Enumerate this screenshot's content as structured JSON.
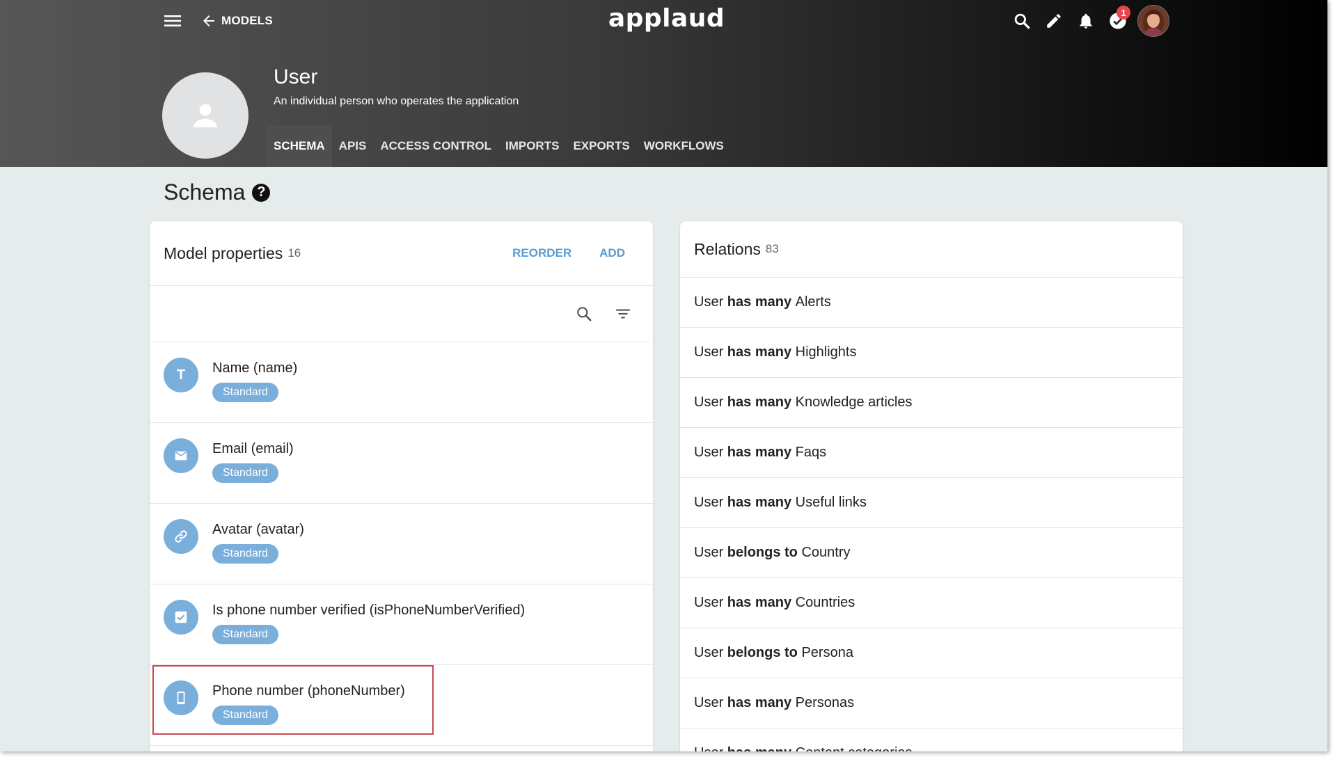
{
  "header": {
    "back_label": "MODELS",
    "logo": "applaud",
    "notification_count": "1",
    "icons": [
      "menu-icon",
      "arrow-left-icon",
      "search-icon",
      "pencil-icon",
      "bell-icon",
      "check-circle-icon"
    ]
  },
  "model": {
    "title": "User",
    "description": "An individual person who operates the application"
  },
  "tabs": [
    {
      "label": "SCHEMA",
      "active": true
    },
    {
      "label": "APIS"
    },
    {
      "label": "ACCESS CONTROL"
    },
    {
      "label": "IMPORTS"
    },
    {
      "label": "EXPORTS"
    },
    {
      "label": "WORKFLOWS"
    }
  ],
  "section": {
    "title": "Schema",
    "help_glyph": "?"
  },
  "properties": {
    "title": "Model properties",
    "count": "16",
    "reorder_label": "REORDER",
    "add_label": "ADD",
    "items": [
      {
        "name": "Name (name)",
        "badge": "Standard",
        "icon": "text-type-icon",
        "icon_glyph": "T"
      },
      {
        "name": "Email (email)",
        "badge": "Standard",
        "icon": "mail-icon"
      },
      {
        "name": "Avatar (avatar)",
        "badge": "Standard",
        "icon": "link-icon"
      },
      {
        "name": "Is phone number verified (isPhoneNumberVerified)",
        "badge": "Standard",
        "icon": "checkbox-icon"
      },
      {
        "name": "Phone number (phoneNumber)",
        "badge": "Standard",
        "icon": "phone-icon"
      }
    ]
  },
  "relations": {
    "title": "Relations",
    "count": "83",
    "items": [
      {
        "subject": "User",
        "verb": "has many",
        "target": "Alerts"
      },
      {
        "subject": "User",
        "verb": "has many",
        "target": "Highlights"
      },
      {
        "subject": "User",
        "verb": "has many",
        "target": "Knowledge articles"
      },
      {
        "subject": "User",
        "verb": "has many",
        "target": "Faqs"
      },
      {
        "subject": "User",
        "verb": "has many",
        "target": "Useful links"
      },
      {
        "subject": "User",
        "verb": "belongs to",
        "target": "Country"
      },
      {
        "subject": "User",
        "verb": "has many",
        "target": "Countries"
      },
      {
        "subject": "User",
        "verb": "belongs to",
        "target": "Persona"
      },
      {
        "subject": "User",
        "verb": "has many",
        "target": "Personas"
      },
      {
        "subject": "User",
        "verb": "has many",
        "target": "Content categories"
      }
    ]
  },
  "colors": {
    "accent": "#5b9bd0",
    "badge_bg": "#7aaedb",
    "highlight": "#c9484f",
    "notification": "#e8454f",
    "page_bg": "#e5eceb"
  }
}
